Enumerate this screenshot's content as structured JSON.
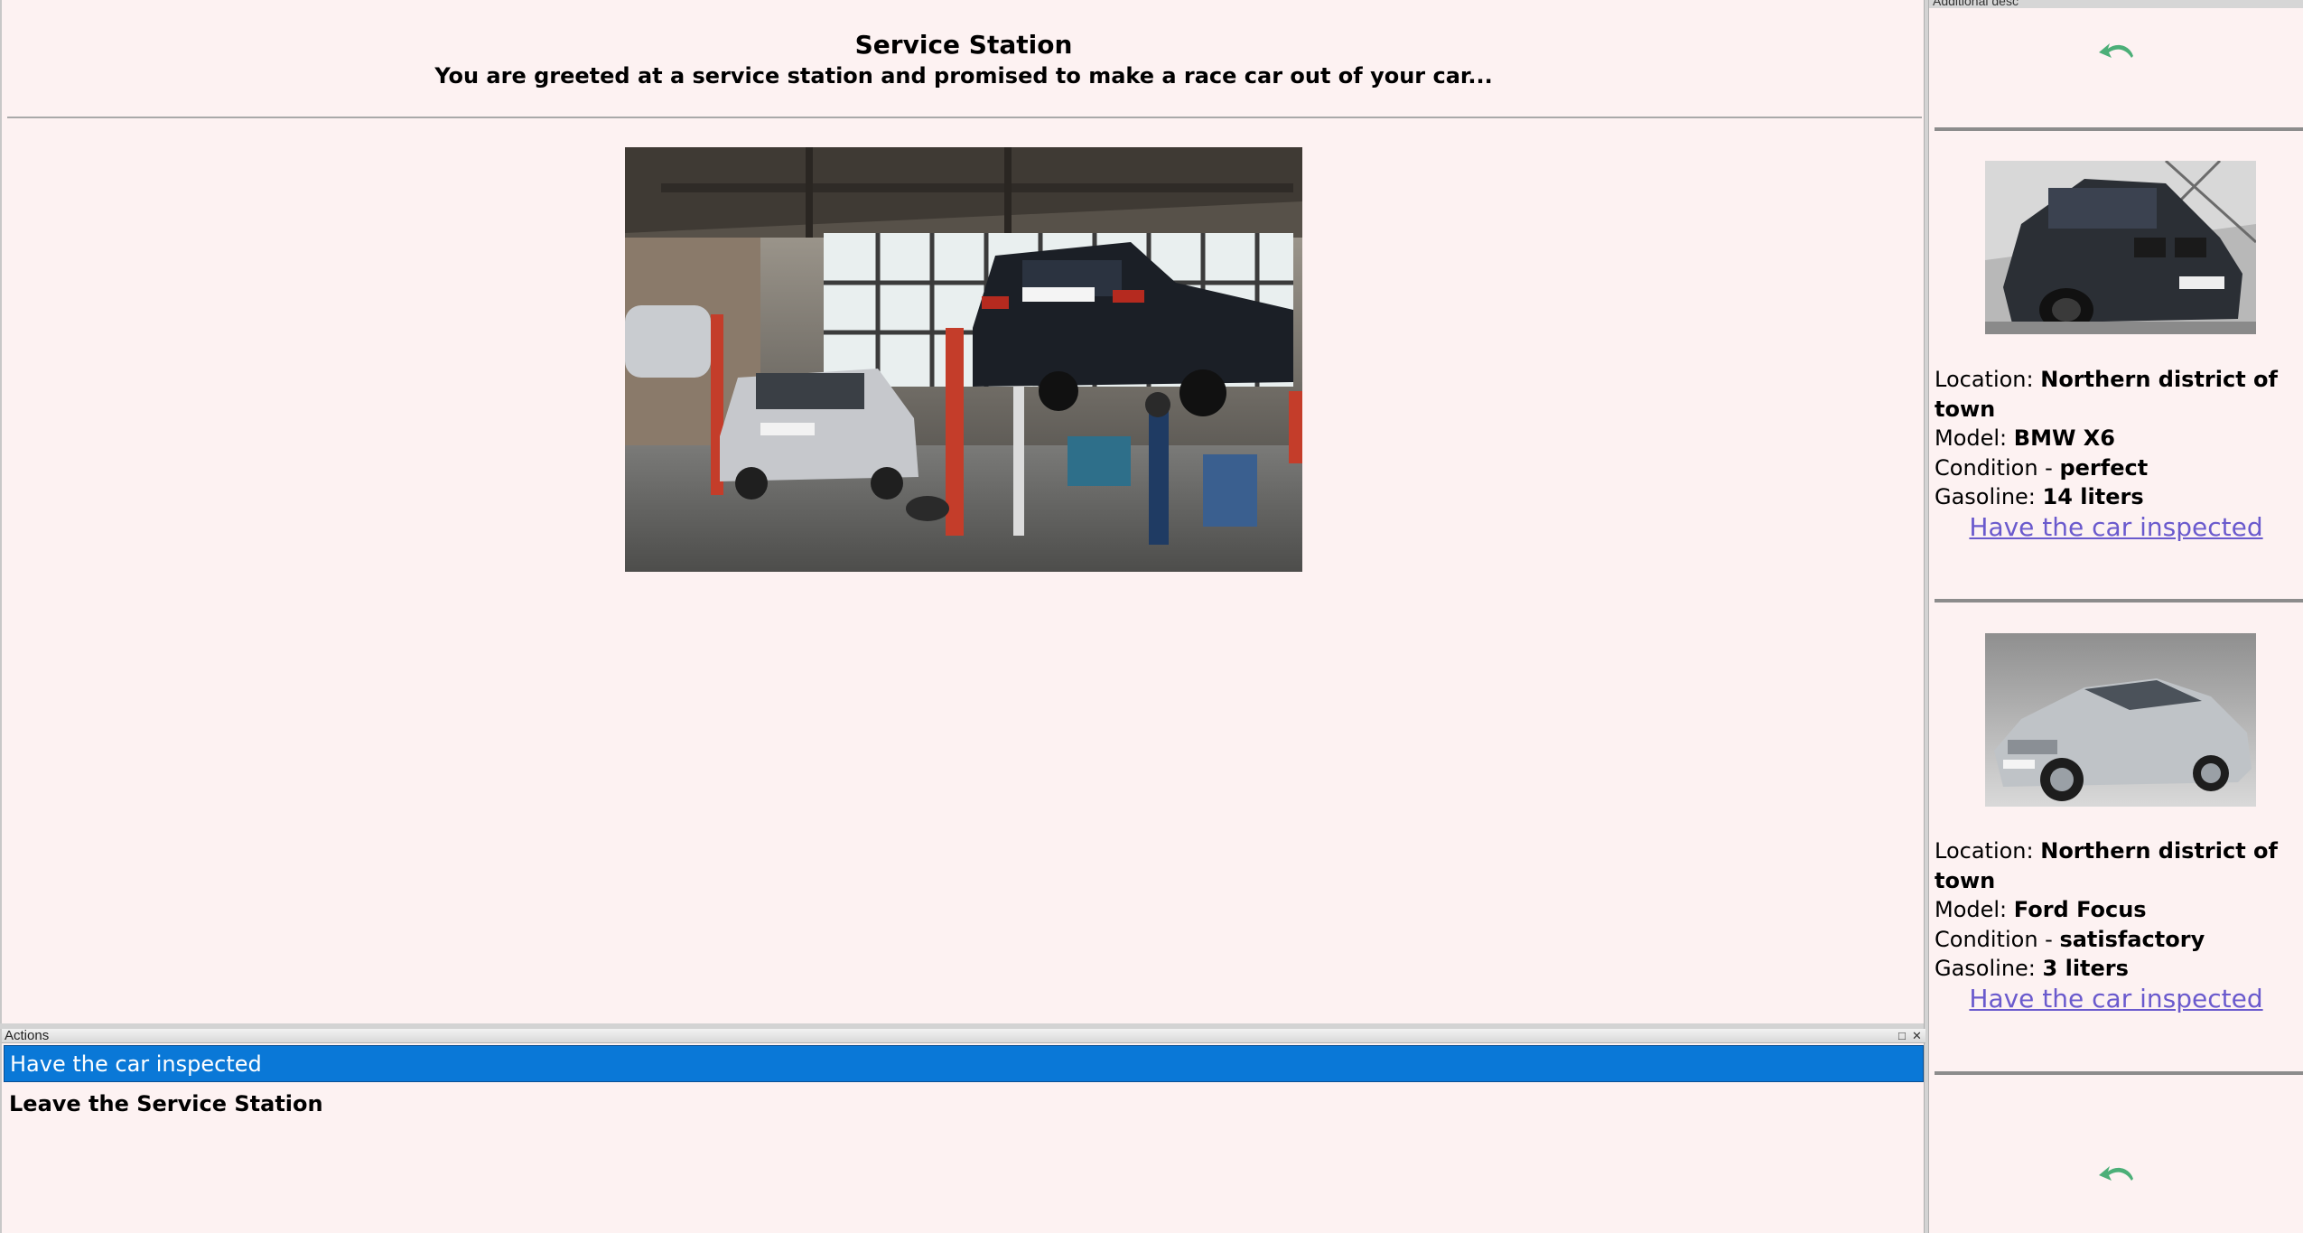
{
  "main": {
    "title": "Service Station",
    "subtitle": "You are greeted at a service station and promised to make a race car out of your car..."
  },
  "actions": {
    "header": "Actions",
    "items": [
      {
        "label": "Have the car inspected",
        "selected": true
      },
      {
        "label": "Leave the Service Station",
        "selected": false
      }
    ]
  },
  "side": {
    "header": "Additional desc",
    "cars": [
      {
        "location_label": "Location: ",
        "location": "Northern district of town",
        "model_label": "Model: ",
        "model": "BMW X6",
        "condition_label": "Condition - ",
        "condition": "perfect",
        "gasoline_label": "Gasoline: ",
        "gasoline": "14 liters",
        "link": "Have the car inspected"
      },
      {
        "location_label": "Location: ",
        "location": "Northern district of town",
        "model_label": "Model: ",
        "model": "Ford Focus",
        "condition_label": "Condition - ",
        "condition": "satisfactory",
        "gasoline_label": "Gasoline: ",
        "gasoline": "3 liters",
        "link": "Have the car inspected"
      }
    ]
  },
  "colors": {
    "background": "#fdf2f2",
    "selection": "#0a78d7",
    "link": "#6a5acd",
    "back_icon": "#4caf78"
  },
  "icons": {
    "back": "back-arrow-icon",
    "restore": "restore-icon",
    "close": "close-icon"
  }
}
